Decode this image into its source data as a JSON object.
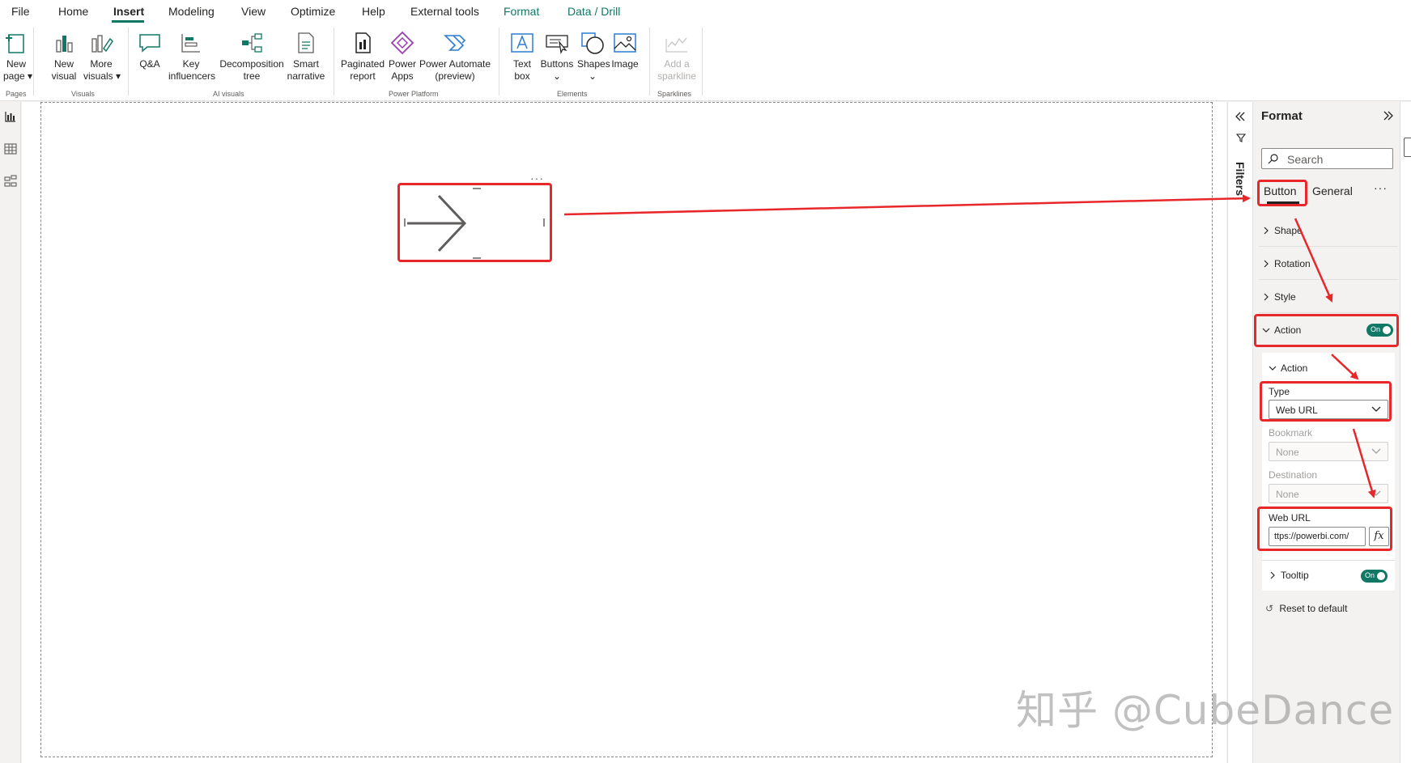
{
  "menu": [
    "File",
    "Home",
    "Insert",
    "Modeling",
    "View",
    "Optimize",
    "Help",
    "External tools",
    "Format",
    "Data / Drill"
  ],
  "ribbon": {
    "new_page": [
      "New",
      "page ▾"
    ],
    "new_visual": [
      "New",
      "visual"
    ],
    "more_visuals": [
      "More",
      "visuals ▾"
    ],
    "qa": "Q&A",
    "key_influencers": [
      "Key",
      "influencers"
    ],
    "decomposition_tree": [
      "Decomposition",
      "tree"
    ],
    "smart_narrative": [
      "Smart",
      "narrative"
    ],
    "paginated_report": [
      "Paginated",
      "report"
    ],
    "power_apps": [
      "Power",
      "Apps"
    ],
    "power_automate": [
      "Power Automate",
      "(preview)"
    ],
    "text_box": [
      "Text",
      "box"
    ],
    "buttons": [
      "Buttons",
      "⌄"
    ],
    "shapes": [
      "Shapes",
      "⌄"
    ],
    "image": "Image",
    "add_sparkline": [
      "Add a",
      "sparkline"
    ],
    "groups": {
      "pages": "Pages",
      "visuals": "Visuals",
      "ai_visuals": "AI visuals",
      "power_platform": "Power Platform",
      "elements": "Elements",
      "sparklines": "Sparklines"
    }
  },
  "canvas": {
    "selection_menu": "···"
  },
  "filters_label": "Filters",
  "format_pane": {
    "title": "Format",
    "search_placeholder": "Search",
    "tabs": [
      "Button",
      "General"
    ],
    "more": "···",
    "sections": {
      "shape": "Shape",
      "rotation": "Rotation",
      "style": "Style",
      "action": "Action",
      "action_toggle": "On"
    },
    "action_card": {
      "header": "Action",
      "type_label": "Type",
      "type_value": "Web URL",
      "bookmark_label": "Bookmark",
      "bookmark_value": "None",
      "destination_label": "Destination",
      "destination_value": "None",
      "web_url_label": "Web URL",
      "web_url_value": "ttps://powerbi.com/",
      "fx": "fx",
      "tooltip_label": "Tooltip",
      "tooltip_toggle": "On"
    },
    "reset": "Reset to default"
  },
  "colors": {
    "accent": "#117865",
    "annotation": "#e8272a"
  },
  "watermark": "知乎 @CubeDance"
}
